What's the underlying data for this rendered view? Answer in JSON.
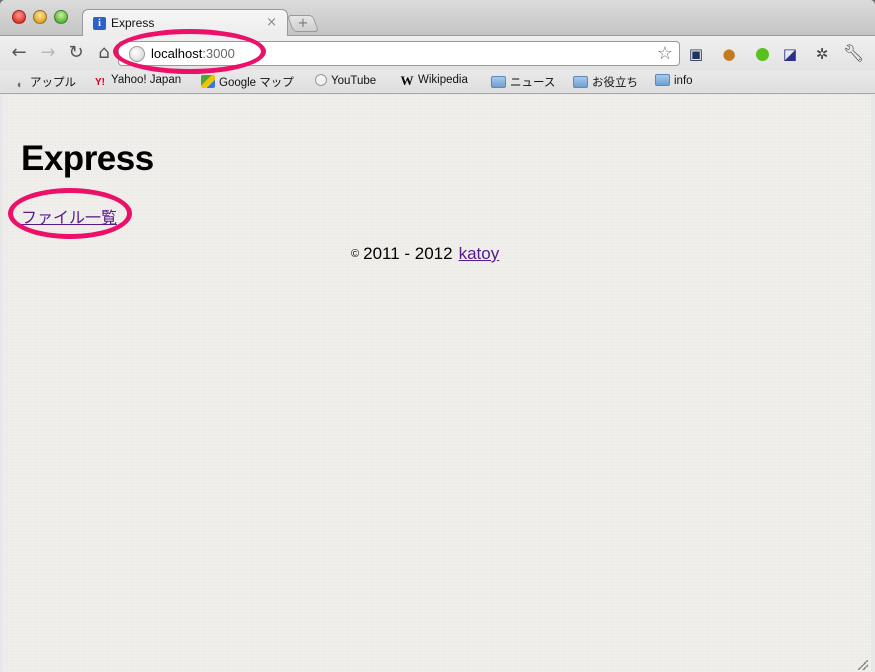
{
  "browser": {
    "tab": {
      "title": "Express",
      "favicon": "info-icon",
      "close_glyph": "×"
    },
    "newtab_glyph": "+",
    "nav": {
      "back": "←",
      "forward": "→",
      "reload": "↻",
      "home": "⌂"
    },
    "address": {
      "host": "localhost",
      "port": ":3000"
    },
    "star_glyph": "☆",
    "extensions": [
      "camera-icon",
      "cookie-icon",
      "green-dot-icon",
      "chart-icon",
      "bug-icon",
      "wrench-icon"
    ]
  },
  "bookmarks": [
    {
      "label": "アップル",
      "icon": "apple-icon"
    },
    {
      "label": "Yahoo! Japan",
      "icon": "yahoo-icon"
    },
    {
      "label": "Google マップ",
      "icon": "google-maps-icon"
    },
    {
      "label": "YouTube",
      "icon": "globe-icon"
    },
    {
      "label": "Wikipedia",
      "icon": "wikipedia-icon"
    },
    {
      "label": "ニュース",
      "icon": "folder-icon"
    },
    {
      "label": "お役立ち",
      "icon": "folder-icon"
    },
    {
      "label": "info",
      "icon": "folder-icon"
    }
  ],
  "page": {
    "title": "Express",
    "file_link": "ファイル一覧",
    "footer": {
      "copyright": "©",
      "years": "2011 - 2012",
      "author": "katoy"
    }
  },
  "colors": {
    "annotation": "#ec1068",
    "visited_link": "#551a8b"
  }
}
